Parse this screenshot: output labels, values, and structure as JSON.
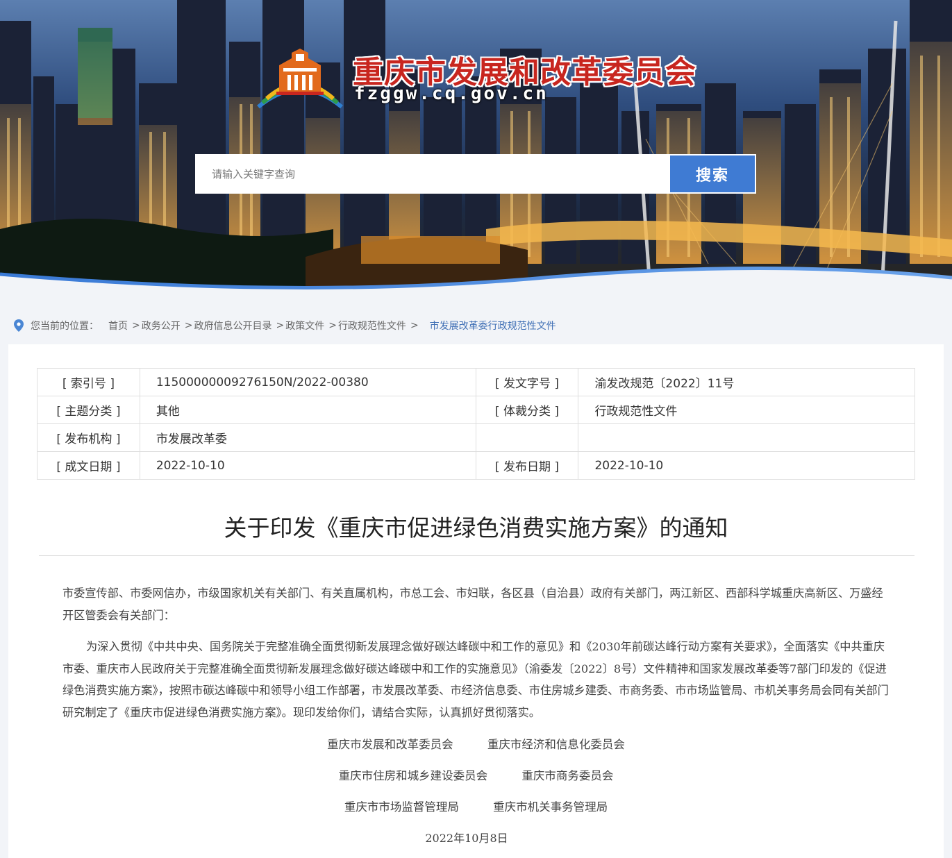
{
  "header": {
    "site_title": "重庆市发展和改革委员会",
    "site_domain": "fzggw.cq.gov.cn",
    "search_placeholder": "请输入关键字查询",
    "search_button": "搜索"
  },
  "breadcrumb": {
    "prefix": "您当前的位置：",
    "items": [
      "首页",
      "政务公开",
      "政府信息公开目录",
      "政策文件",
      "行政规范性文件"
    ],
    "current": "市发展改革委行政规范性文件"
  },
  "meta": {
    "rows": [
      {
        "k1": "[ 索引号 ]",
        "v1": "11500000009276150N/2022-00380",
        "k2": "[ 发文字号 ]",
        "v2": "渝发改规范〔2022〕11号"
      },
      {
        "k1": "[ 主题分类 ]",
        "v1": "其他",
        "k2": "[ 体裁分类 ]",
        "v2": "行政规范性文件"
      },
      {
        "k1": "[ 发布机构 ]",
        "v1": "市发展改革委",
        "k2": "",
        "v2": ""
      },
      {
        "k1": "[ 成文日期 ]",
        "v1": "2022-10-10",
        "k2": "[ 发布日期 ]",
        "v2": "2022-10-10"
      }
    ]
  },
  "document": {
    "title": "关于印发《重庆市促进绿色消费实施方案》的通知",
    "addressee": "市委宣传部、市委网信办，市级国家机关有关部门、有关直属机构，市总工会、市妇联，各区县（自治县）政府有关部门，两江新区、西部科学城重庆高新区、万盛经开区管委会有关部门：",
    "body": "为深入贯彻《中共中央、国务院关于完整准确全面贯彻新发展理念做好碳达峰碳中和工作的意见》和《2030年前碳达峰行动方案有关要求》，全面落实《中共重庆市委、重庆市人民政府关于完整准确全面贯彻新发展理念做好碳达峰碳中和工作的实施意见》（渝委发〔2022〕8号）文件精神和国家发展改革委等7部门印发的《促进绿色消费实施方案》，按照市碳达峰碳中和领导小组工作部署，市发展改革委、市经济信息委、市住房城乡建委、市商务委、市市场监管局、市机关事务局会同有关部门研究制定了《重庆市促进绿色消费实施方案》。现印发给你们，请结合实际，认真抓好贯彻落实。",
    "signatories": [
      [
        "重庆市发展和改革委员会",
        "重庆市经济和信息化委员会"
      ],
      [
        "重庆市住房和城乡建设委员会",
        "重庆市商务委员会"
      ],
      [
        "重庆市市场监督管理局",
        "重庆市机关事务管理局"
      ]
    ],
    "date": "2022年10月8日"
  },
  "colors": {
    "brand_red": "#c8261f",
    "search_blue": "#3f7bd3",
    "breadcrumb_current": "#3f6fb5"
  }
}
